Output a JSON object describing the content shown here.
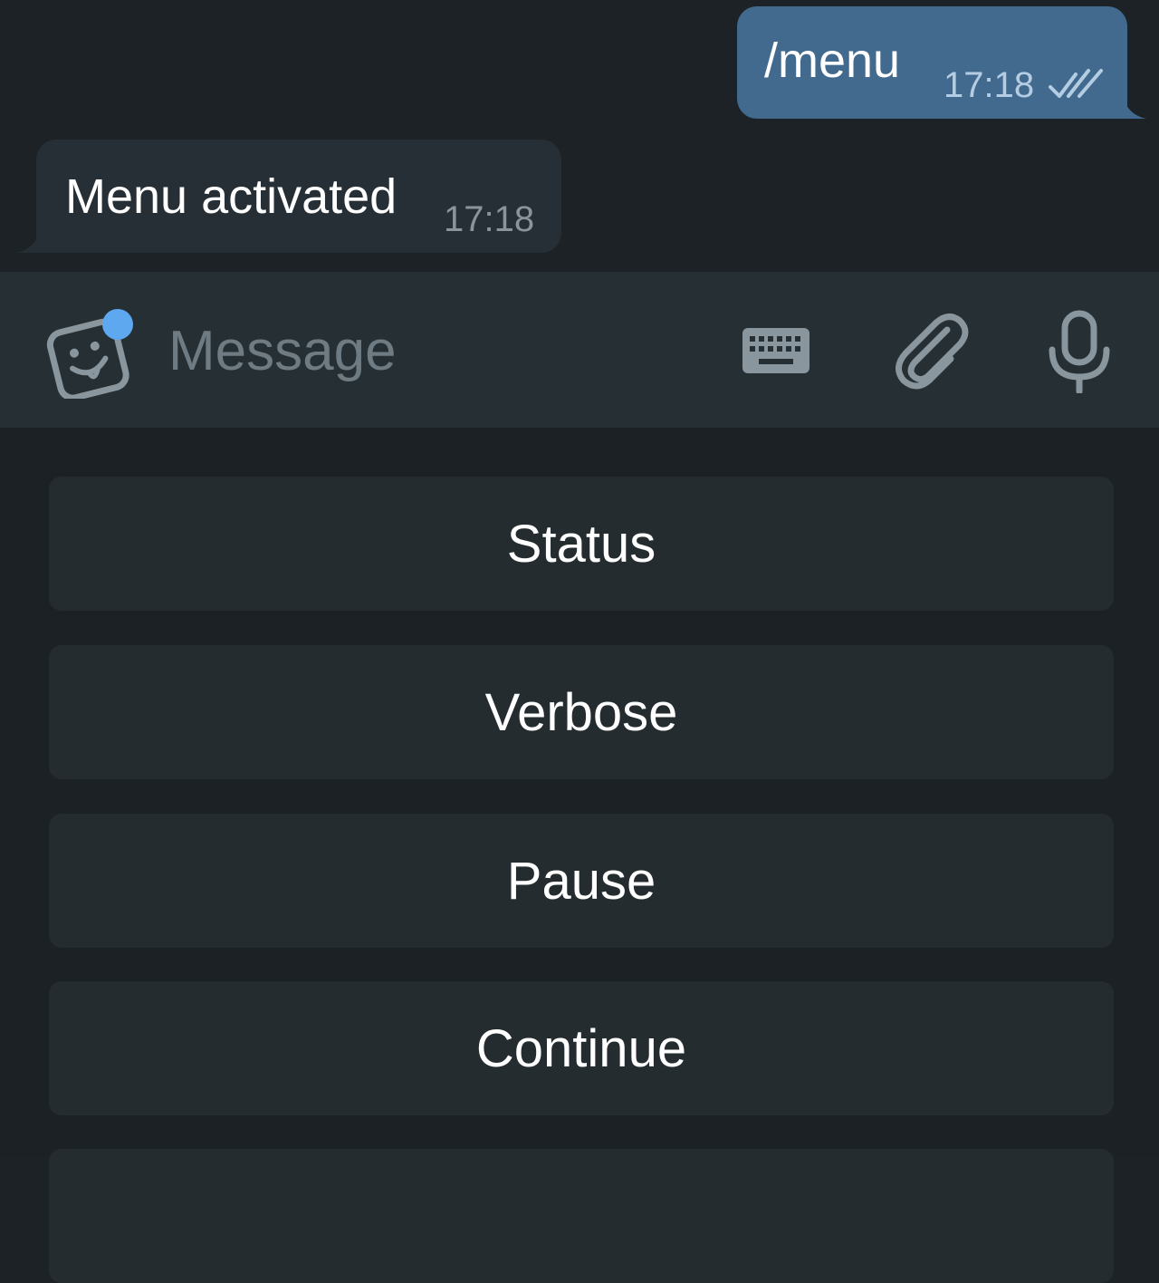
{
  "messages": {
    "outgoing": {
      "text": "/menu",
      "time": "17:18",
      "status_icon": "double-check-icon"
    },
    "incoming": {
      "text": "Menu activated",
      "time": "17:18"
    }
  },
  "composer": {
    "placeholder": "Message",
    "icons": [
      "sticker-emoji-icon",
      "keyboard-icon",
      "paperclip-icon",
      "microphone-icon"
    ]
  },
  "reply_keyboard": {
    "buttons": [
      "Status",
      "Verbose",
      "Pause",
      "Continue"
    ]
  },
  "colors": {
    "background": "#1c2226",
    "outgoing_bubble": "#416a8e",
    "incoming_bubble": "#262f35",
    "composer_bar": "#262f33",
    "keyboard_button": "#252c30",
    "accent_dot": "#5ea8f0",
    "icon_gray": "#8a969d"
  }
}
